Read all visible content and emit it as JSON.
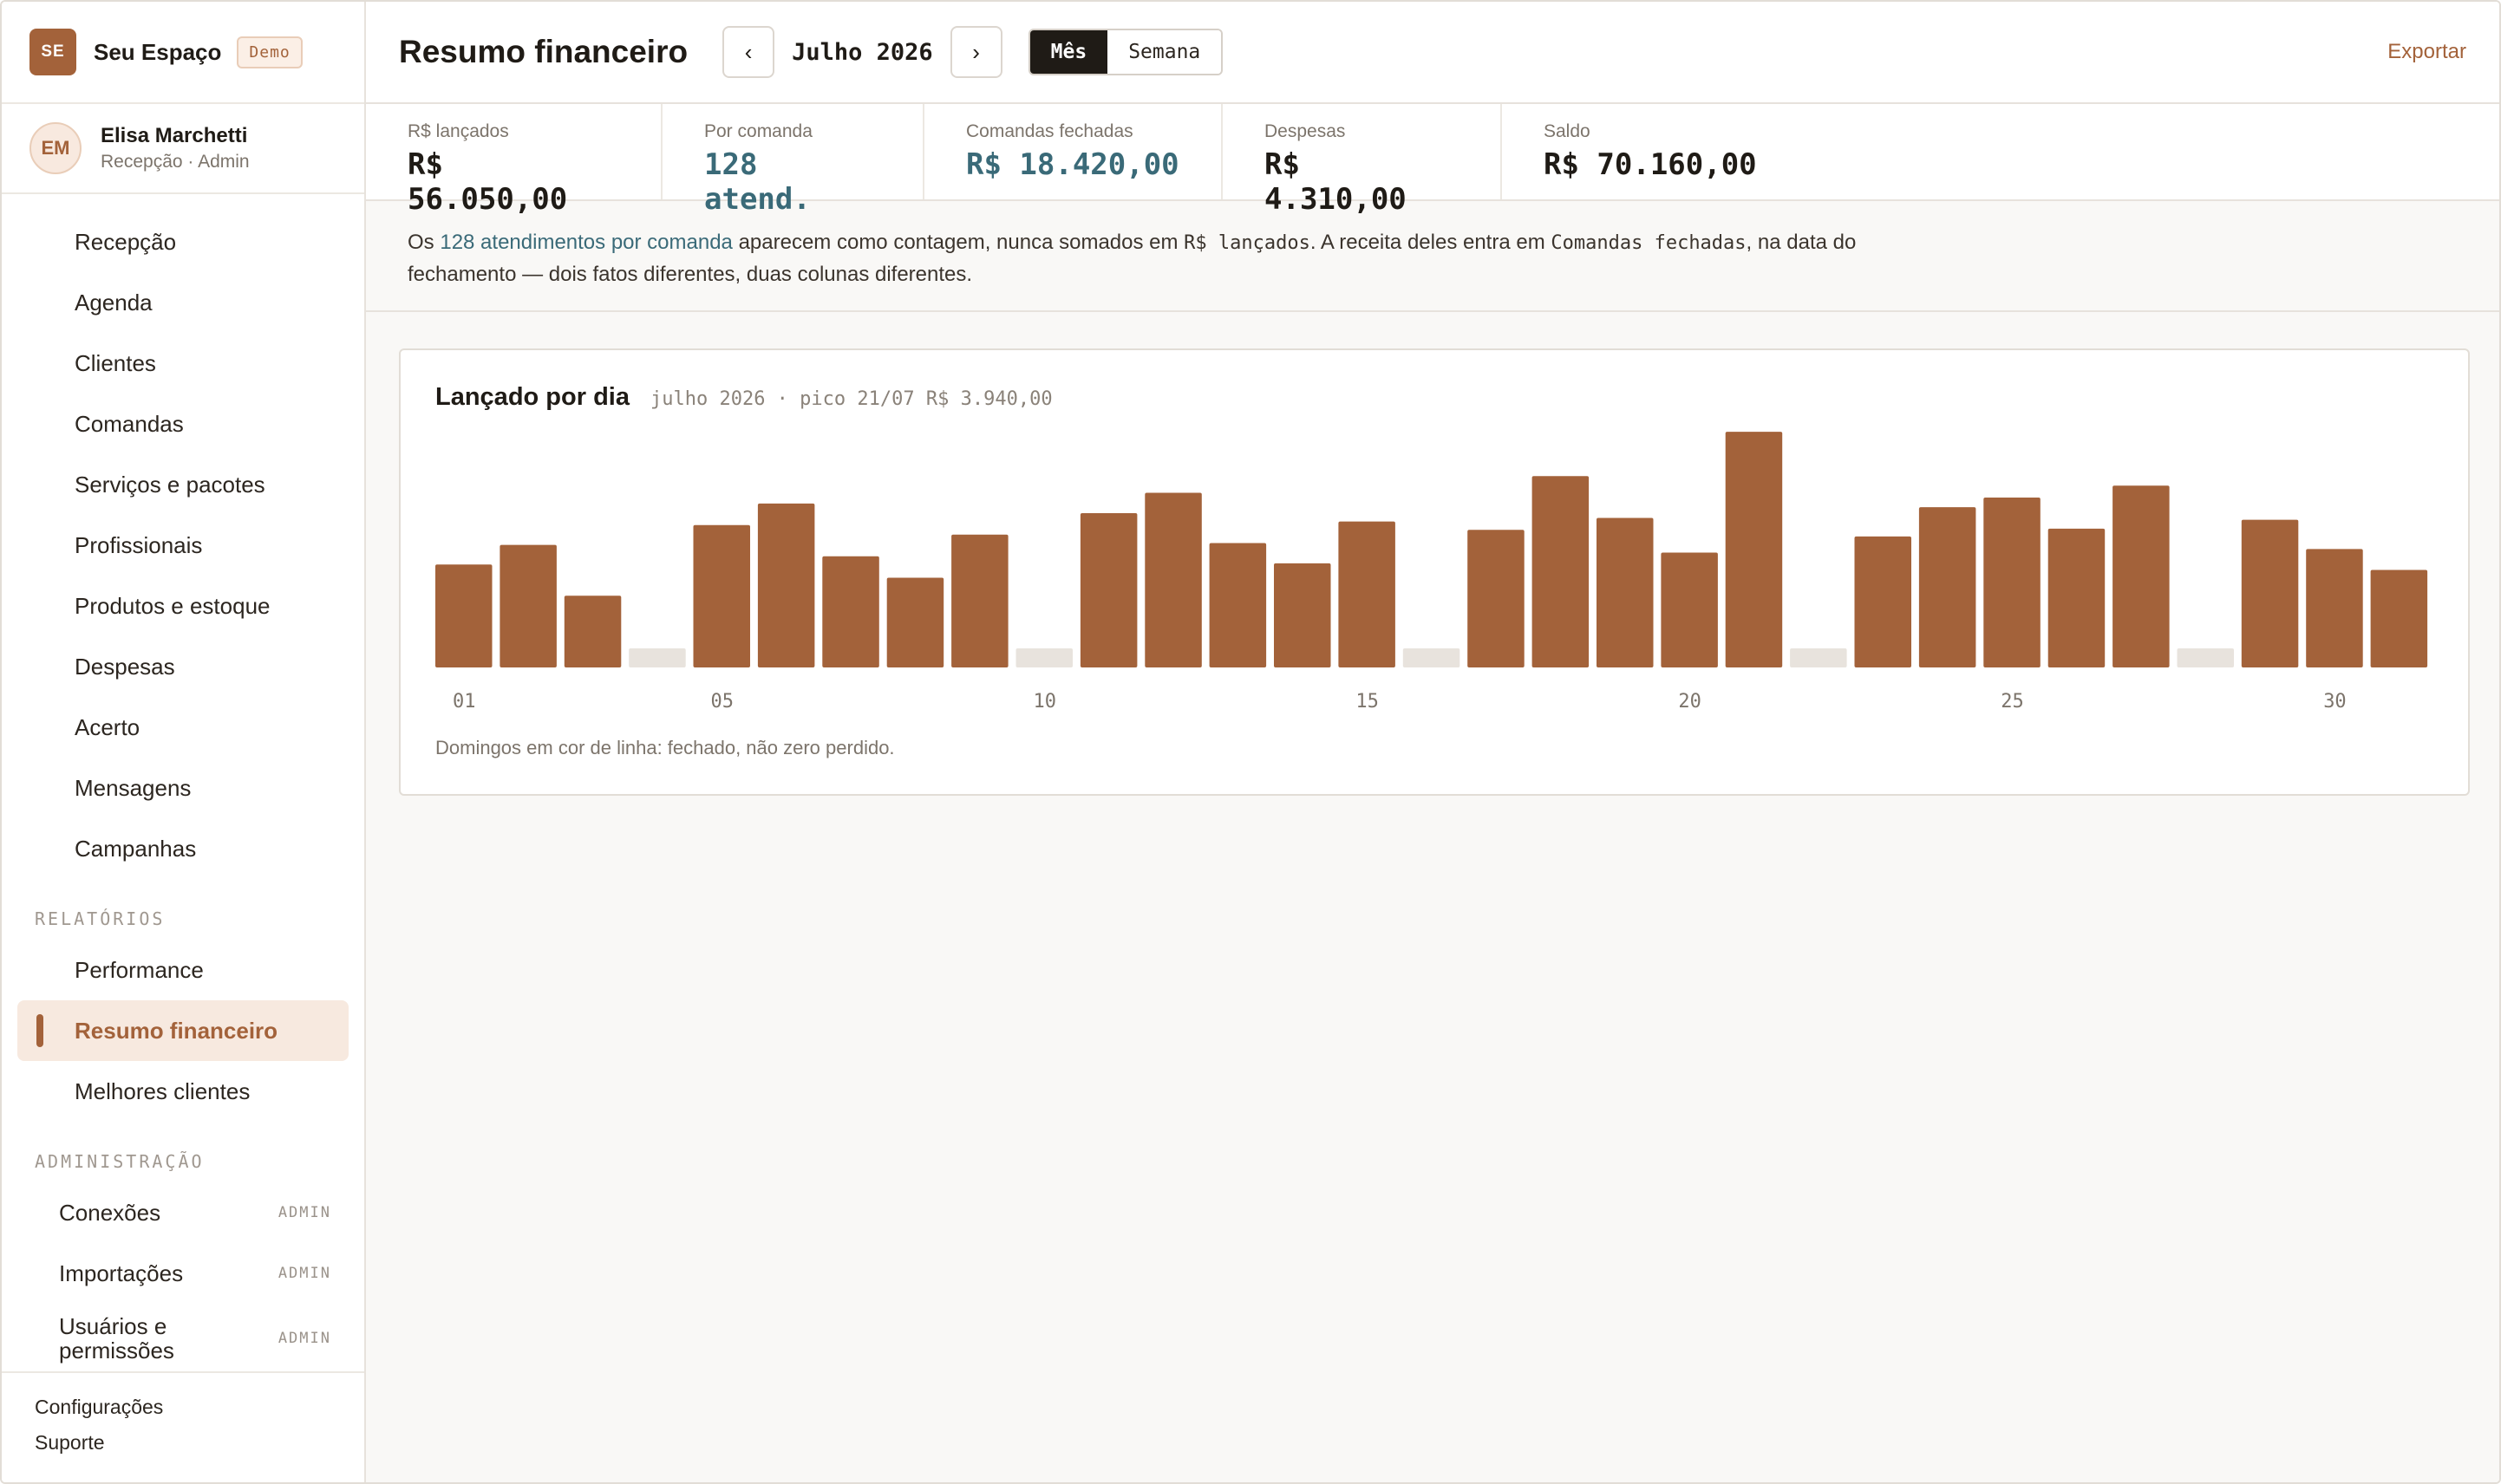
{
  "brand": {
    "initials": "SE",
    "name": "Seu Espaço",
    "badge": "Demo"
  },
  "user": {
    "initials": "EM",
    "name": "Elisa Marchetti",
    "role": "Recepção · Admin"
  },
  "nav": {
    "main": [
      "Recepção",
      "Agenda",
      "Clientes",
      "Comandas",
      "Serviços e pacotes",
      "Profissionais",
      "Produtos e estoque",
      "Despesas",
      "Acerto",
      "Mensagens",
      "Campanhas"
    ],
    "reports_title": "RELATÓRIOS",
    "reports": [
      "Performance",
      "Resumo financeiro",
      "Melhores clientes"
    ],
    "admin_title": "ADMINISTRAÇÃO",
    "admin": [
      {
        "label": "Conexões",
        "tag": "ADMIN"
      },
      {
        "label": "Importações",
        "tag": "ADMIN"
      },
      {
        "label": "Usuários e permissões",
        "tag": "ADMIN"
      }
    ],
    "footer": [
      "Configurações",
      "Suporte"
    ]
  },
  "header": {
    "title": "Resumo financeiro",
    "prev": "‹",
    "period": "Julho 2026",
    "next": "›",
    "modes": [
      "Mês",
      "Semana"
    ],
    "active_mode": "Mês",
    "export": "Exportar"
  },
  "kpis": [
    {
      "label": "R$ lançados",
      "value": "R$ 56.050,00",
      "accent": false
    },
    {
      "label": "Por comanda",
      "value": "128 atend.",
      "accent": true
    },
    {
      "label": "Comandas fechadas",
      "value": "R$ 18.420,00",
      "accent": true
    },
    {
      "label": "Despesas",
      "value": "R$ 4.310,00",
      "accent": false
    },
    {
      "label": "Saldo",
      "value": "R$ 70.160,00",
      "accent": false
    }
  ],
  "note": {
    "p1": "Os ",
    "link": "128 atendimentos por comanda",
    "p2": " aparecem como contagem, nunca somados em ",
    "code1": "R$ lançados",
    "p3": ". A receita deles entra em ",
    "code2": "Comandas fechadas",
    "p4": ", na data do",
    "p5": "fechamento — dois fatos diferentes, duas colunas diferentes."
  },
  "card": {
    "title": "Lançado por dia",
    "subtitle": "julho 2026 · pico 21/07 R$ 3.940,00",
    "footnote": "Domingos em cor de linha: fechado, não zero perdido."
  },
  "colors": {
    "accent": "#a3623a",
    "closed": "#e8e3dd",
    "teal": "#3a6a78"
  },
  "chart_data": {
    "type": "bar",
    "categories": [
      "01",
      "02",
      "03",
      "04",
      "05",
      "06",
      "07",
      "08",
      "09",
      "10",
      "11",
      "12",
      "13",
      "14",
      "15",
      "16",
      "17",
      "18",
      "19",
      "20",
      "21",
      "22",
      "23",
      "24",
      "25",
      "26",
      "27",
      "28",
      "29",
      "30",
      "31"
    ],
    "tick_labels": [
      "01",
      "05",
      "10",
      "15",
      "20",
      "25",
      "30"
    ],
    "values": [
      1720,
      2050,
      1200,
      0,
      2380,
      2740,
      1860,
      1500,
      2220,
      0,
      2580,
      2920,
      2080,
      1740,
      2440,
      0,
      2300,
      3200,
      2500,
      1920,
      3940,
      0,
      2190,
      2680,
      2840,
      2320,
      3040,
      0,
      2470,
      1980,
      1630
    ],
    "closed_days": [
      "04",
      "10",
      "16",
      "22",
      "28"
    ],
    "ylim": [
      0,
      4000
    ]
  }
}
